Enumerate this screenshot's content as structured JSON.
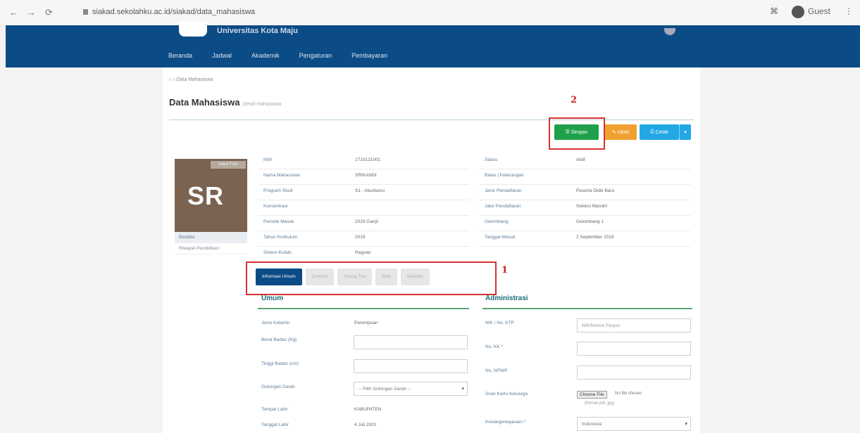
{
  "browser": {
    "back": "←",
    "forward": "→",
    "reload": "⟳",
    "url": "siakad.sekolahku.ac.id/siakad/data_mahasiswa",
    "profile_label": "Guest",
    "menu": "⋮",
    "translate": "⌘"
  },
  "header": {
    "university": "Universitas Kota Maju",
    "nav": [
      "Beranda",
      "Jadwal",
      "Akademik",
      "Pengaturan",
      "Pembayaran"
    ]
  },
  "breadcrumb": "Data Mahasiswa",
  "page": {
    "title": "Data Mahasiswa",
    "subtitle": "Detail mahasiswa"
  },
  "actions": {
    "simpan": "Simpan",
    "ubah": "Ubah",
    "cetak": "Cetak",
    "dropdown": "▾"
  },
  "annotations": {
    "one": "1",
    "two": "2"
  },
  "profile": {
    "initials": "SR",
    "change_photo": "Ganti Foto",
    "menu": [
      "Biodata",
      "Riwayat Pendidikan"
    ]
  },
  "info_left": [
    {
      "k": "NIM",
      "v": "1710121001"
    },
    {
      "k": "Nama Mahasiswa",
      "v": "SRIKANDI"
    },
    {
      "k": "Program Studi",
      "v": "S1 - Akuntansi"
    },
    {
      "k": "Konsentrasi",
      "v": ""
    },
    {
      "k": "Periode Masuk",
      "v": "2019 Ganjil"
    },
    {
      "k": "Tahun Kurikulum",
      "v": "2019"
    },
    {
      "k": "Sistem Kuliah",
      "v": "Reguler"
    }
  ],
  "info_right": [
    {
      "k": "Status",
      "v": "Aktif"
    },
    {
      "k": "Batas | Keterangan",
      "v": ""
    },
    {
      "k": "Jenis Pendaftaran",
      "v": "Peserta Didik Baru"
    },
    {
      "k": "Jalur Pendaftaran",
      "v": "Seleksi Mandiri"
    },
    {
      "k": "Gelombang",
      "v": "Gelombang 1"
    },
    {
      "k": "Tanggal Masuk",
      "v": "2 September 2019"
    }
  ],
  "tabs": [
    "Informasi Umum",
    "Domisili",
    "Orang Tua",
    "Wali",
    "Sekolah"
  ],
  "umum": {
    "title": "Umum",
    "fields": [
      {
        "label": "Jenis Kelamin",
        "value": "Perempuan"
      },
      {
        "label": "Berat Badan (Kg)",
        "value": ""
      },
      {
        "label": "Tinggi Badan (cm)",
        "value": ""
      },
      {
        "label": "Golongan Darah",
        "value": "-- Pilih Golongan Darah --"
      },
      {
        "label": "Tempat Lahir",
        "value": "KABUPATEN"
      },
      {
        "label": "Tanggal Lahir",
        "value": "4 Juli 2001"
      }
    ]
  },
  "administrasi": {
    "title": "Administrasi",
    "fields": [
      {
        "label": "NIK / No. KTP",
        "value": "",
        "placeholder": "NIK/Nomor Paspor"
      },
      {
        "label": "No. KK *",
        "value": ""
      },
      {
        "label": "No. NPWP",
        "value": ""
      },
      {
        "label": "Scan Kartu Keluarga",
        "value": "Choose File"
      },
      {
        "label": "Kewarganegaraan *",
        "value": "Indonesia"
      }
    ],
    "file_text": "No file chosen",
    "file_hint": "(format pdf, jpg)"
  }
}
